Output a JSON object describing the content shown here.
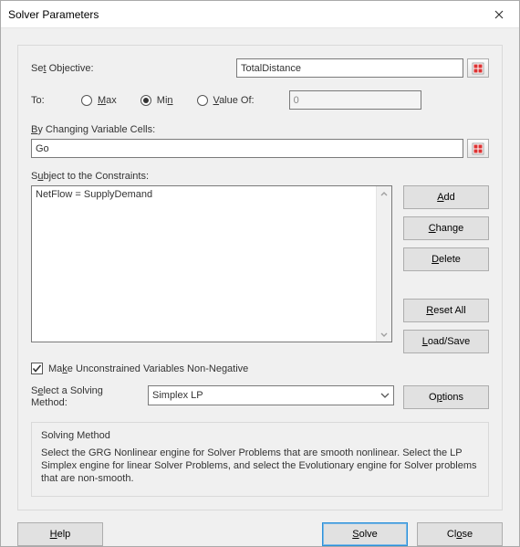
{
  "window": {
    "title": "Solver Parameters"
  },
  "objective": {
    "label_pre": "Se",
    "label_u": "t",
    "label_post": " Objective:",
    "value": "TotalDistance"
  },
  "to": {
    "label": "To:",
    "max_u": "M",
    "max_post": "ax",
    "min_pre": "Mi",
    "min_u": "n",
    "value_u": "V",
    "value_post": "alue Of:",
    "value_of_value": "0",
    "selected": "min"
  },
  "bychanging": {
    "label_u": "B",
    "label_post": "y Changing Variable Cells:",
    "value": "Go"
  },
  "constraints": {
    "label_pre": "S",
    "label_u": "u",
    "label_post": "bject to the Constraints:",
    "items": [
      "NetFlow = SupplyDemand"
    ],
    "buttons": {
      "add_u": "A",
      "add_post": "dd",
      "change_u": "C",
      "change_post": "hange",
      "delete_u": "D",
      "delete_post": "elete",
      "reset_u": "R",
      "reset_post": "eset All",
      "load_u": "L",
      "load_post": "oad/Save"
    }
  },
  "unconstrained": {
    "checked": true,
    "pre": "Ma",
    "u": "k",
    "post": "e Unconstrained Variables Non-Negative"
  },
  "method": {
    "label_pre": "S",
    "label_u": "e",
    "label_post": "lect a Solving Method:",
    "value": "Simplex LP",
    "options_pre": "O",
    "options_u": "p",
    "options_post": "tions"
  },
  "desc": {
    "header": "Solving Method",
    "text": "Select the GRG Nonlinear engine for Solver Problems that are smooth nonlinear. Select the LP Simplex engine for linear Solver Problems, and select the Evolutionary engine for Solver problems that are non-smooth."
  },
  "footer": {
    "help_u": "H",
    "help_post": "elp",
    "solve_u": "S",
    "solve_post": "olve",
    "close_pre": "Cl",
    "close_u": "o",
    "close_post": "se"
  }
}
